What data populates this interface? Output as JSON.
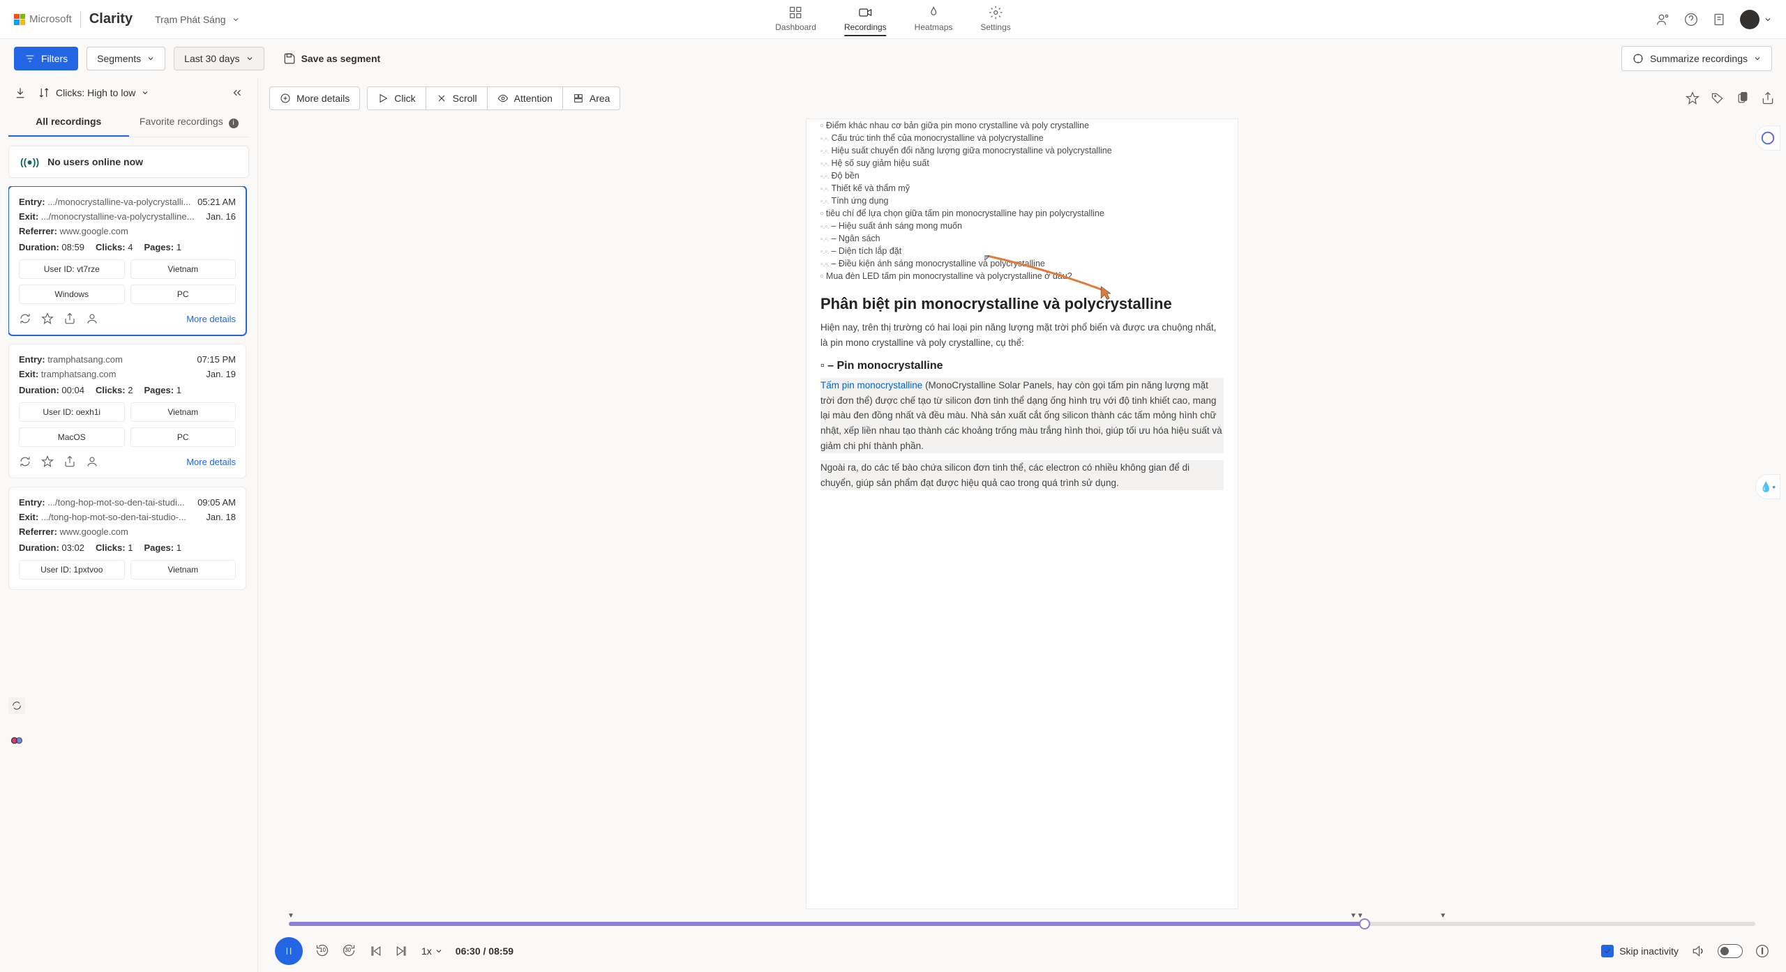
{
  "header": {
    "ms": "Microsoft",
    "product": "Clarity",
    "project": "Trạm Phát Sáng",
    "nav": [
      {
        "label": "Dashboard"
      },
      {
        "label": "Recordings"
      },
      {
        "label": "Heatmaps"
      },
      {
        "label": "Settings"
      }
    ]
  },
  "toolbar": {
    "filters": "Filters",
    "segments": "Segments",
    "date_range": "Last 30 days",
    "save_segment": "Save as segment",
    "summarize": "Summarize recordings"
  },
  "sidebar": {
    "sort": "Clicks: High to low",
    "tab_all": "All recordings",
    "tab_fav": "Favorite recordings",
    "live_banner": "No users online now",
    "more_details": "More details"
  },
  "recordings": [
    {
      "entry_label": "Entry:",
      "entry": ".../monocrystalline-va-polycrystalli...",
      "exit_label": "Exit:",
      "exit": ".../monocrystalline-va-polycrystalline...",
      "referrer_label": "Referrer:",
      "referrer": "www.google.com",
      "time": "05:21 AM",
      "date": "Jan. 16",
      "duration_label": "Duration:",
      "duration": "08:59",
      "clicks_label": "Clicks:",
      "clicks": "4",
      "pages_label": "Pages:",
      "pages": "1",
      "tags": [
        "User ID: vt7rze",
        "Vietnam",
        "Windows",
        "PC"
      ]
    },
    {
      "entry_label": "Entry:",
      "entry": "tramphatsang.com",
      "exit_label": "Exit:",
      "exit": "tramphatsang.com",
      "time": "07:15 PM",
      "date": "Jan. 19",
      "duration_label": "Duration:",
      "duration": "00:04",
      "clicks_label": "Clicks:",
      "clicks": "2",
      "pages_label": "Pages:",
      "pages": "1",
      "tags": [
        "User ID: oexh1i",
        "Vietnam",
        "MacOS",
        "PC"
      ]
    },
    {
      "entry_label": "Entry:",
      "entry": ".../tong-hop-mot-so-den-tai-studi...",
      "exit_label": "Exit:",
      "exit": ".../tong-hop-mot-so-den-tai-studio-...",
      "referrer_label": "Referrer:",
      "referrer": "www.google.com",
      "time": "09:05 AM",
      "date": "Jan. 18",
      "duration_label": "Duration:",
      "duration": "03:02",
      "clicks_label": "Clicks:",
      "clicks": "1",
      "pages_label": "Pages:",
      "pages": "1",
      "tags": [
        "User ID: 1pxtvoo",
        "Vietnam"
      ]
    }
  ],
  "content_toolbar": {
    "more_details": "More details",
    "click": "Click",
    "scroll": "Scroll",
    "attention": "Attention",
    "area": "Area"
  },
  "page": {
    "toc": [
      {
        "lvl": 1,
        "text": "Điểm khác nhau cơ bản giữa pin mono crystalline và poly crystalline"
      },
      {
        "lvl": 2,
        "text": "Cấu trúc tinh thể của monocrystalline và polycrystalline"
      },
      {
        "lvl": 2,
        "text": "Hiệu suất chuyển đổi năng lượng giữa monocrystalline và polycrystalline"
      },
      {
        "lvl": 2,
        "text": "Hệ số suy giảm hiệu suất"
      },
      {
        "lvl": 2,
        "text": "Độ bền"
      },
      {
        "lvl": 2,
        "text": "Thiết kế và thẩm mỹ"
      },
      {
        "lvl": 2,
        "text": "Tính ứng dụng"
      },
      {
        "lvl": 1,
        "text": "tiêu chí để lựa chọn giữa tấm pin monocrystalline hay pin polycrystalline"
      },
      {
        "lvl": 2,
        "text": "– Hiệu suất ánh sáng mong muốn"
      },
      {
        "lvl": 2,
        "text": "– Ngân sách"
      },
      {
        "lvl": 2,
        "text": "– Diện tích lắp đặt"
      },
      {
        "lvl": 2,
        "text": "– Điều kiện ánh sáng monocrystalline và polycrystalline"
      },
      {
        "lvl": 1,
        "text": "Mua đèn LED tấm pin monocrystalline và polycrystalline ở đâu?"
      }
    ],
    "h2": "Phân biệt pin monocrystalline và polycrystalline",
    "p1": "Hiện nay, trên thị trường có hai loại pin năng lượng mặt trời phổ biến và được ưa chuộng nhất, là pin mono crystalline và poly crystalline, cụ thể:",
    "h3": "▫ – Pin monocrystalline",
    "link": "Tấm pin monocrystalline",
    "p2": " (MonoCrystalline Solar Panels, hay còn gọi tấm pin năng lượng mặt trời đơn thể) được chế tạo từ silicon đơn tinh thể dạng ống hình trụ với độ tinh khiết cao, mang lại màu đen đồng nhất và đều màu. Nhà sản xuất cắt ống silicon thành các tấm mỏng hình chữ nhật, xếp liền nhau tạo thành các khoảng trống màu trắng hình thoi, giúp tối ưu hóa hiệu suất và giảm chi phí thành phần.",
    "p3": "Ngoài ra, do các tế bào chứa silicon đơn tinh thể, các electron có nhiều không gian để di chuyển, giúp sản phẩm đạt được hiệu quả cao trong quá trình sử dụng."
  },
  "playback": {
    "speed": "1x",
    "current": "06:30",
    "total": "08:59",
    "skip_label": "Skip inactivity",
    "rewind": "10",
    "forward": "30"
  }
}
